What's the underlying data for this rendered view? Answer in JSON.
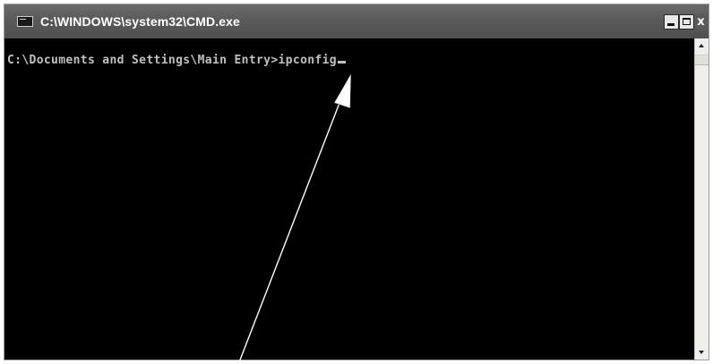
{
  "window": {
    "title": "C:\\WINDOWS\\system32\\CMD.exe",
    "icon": "console-app-icon"
  },
  "controls": {
    "minimize": "_",
    "maximize": "□",
    "close": "x"
  },
  "console": {
    "prompt": "C:\\Documents and Settings\\Main Entry>",
    "command": "ipconfig",
    "background": "#000000",
    "text_color": "#c0c0c0"
  },
  "annotation": {
    "type": "arrow",
    "color": "#ffffff"
  }
}
